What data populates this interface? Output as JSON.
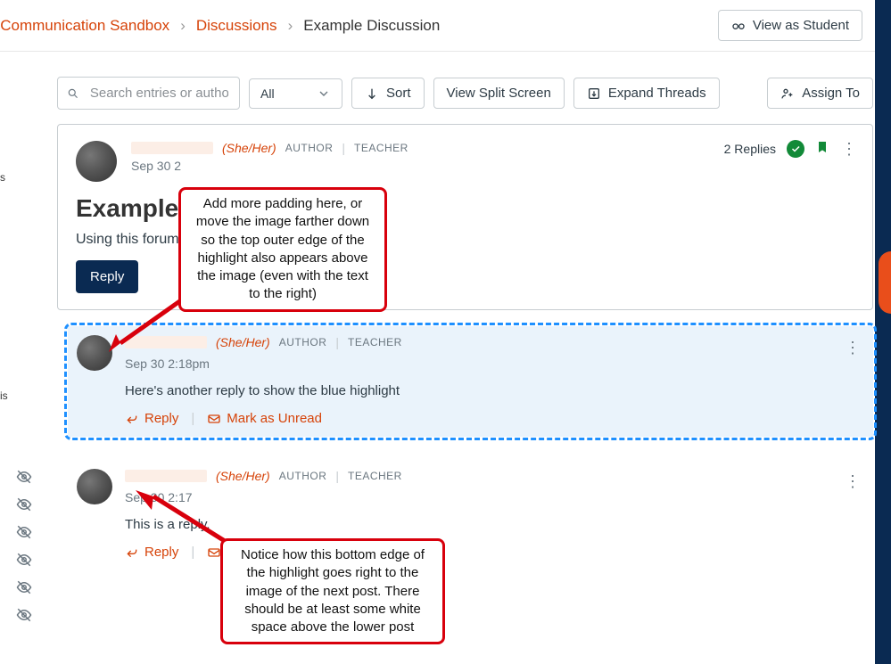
{
  "breadcrumbs": {
    "course_fragment": "g & Communication Sandbox",
    "discussions": "Discussions",
    "current": "Example Discussion"
  },
  "topbar": {
    "view_as": "View as Student"
  },
  "toolbar": {
    "search_placeholder": "Search entries or author...",
    "filter_label": "All",
    "sort_label": "Sort",
    "split_label": "View Split Screen",
    "expand_label": "Expand Threads",
    "assign_label": "Assign To"
  },
  "post": {
    "pronoun": "(She/Her)",
    "role_author": "AUTHOR",
    "role_teacher": "TEACHER",
    "timestamp": "Sep 30 2",
    "title": "Example",
    "body": "Using this forum                                                                 n interface.",
    "reply_label": "Reply",
    "replies_count": "2 Replies"
  },
  "replies": [
    {
      "pronoun": "(She/Her)",
      "role_author": "AUTHOR",
      "role_teacher": "TEACHER",
      "timestamp": "Sep 30 2:18pm",
      "body": "Here's another reply to show the blue highlight",
      "reply_label": "Reply",
      "mark_unread": "Mark as Unread"
    },
    {
      "pronoun": "(She/Her)",
      "role_author": "AUTHOR",
      "role_teacher": "TEACHER",
      "timestamp": "Sep 30 2:17",
      "body": "This is a reply.",
      "reply_label": "Reply"
    }
  ],
  "callouts": {
    "top": "Add more padding here, or move the image farther down so the top outer edge of the highlight also appears above the image (even with the text to the right)",
    "bottom": "Notice how this bottom edge of the highlight goes right to the image of the next post. There should be at least some white space above the lower post"
  },
  "left_fragments": {
    "a": "s",
    "b": "is"
  }
}
